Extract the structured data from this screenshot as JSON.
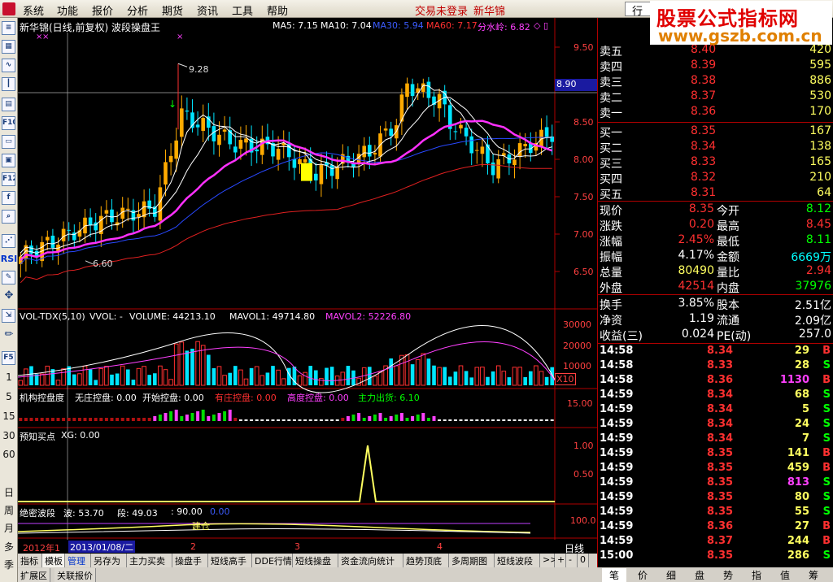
{
  "menu": {
    "items": [
      "系统",
      "功能",
      "报价",
      "分析",
      "期货",
      "资讯",
      "工具",
      "帮助"
    ],
    "status_login": "交易未登录",
    "stock_name": "新华锦",
    "hang": "行"
  },
  "watermark": {
    "line1": "股票公式指标网",
    "line2": "www.gszb.com.cn"
  },
  "left_toolbar": {
    "rsi": "RSI",
    "f5": "F5",
    "periods": [
      "1",
      "5",
      "15",
      "30",
      "60",
      "日",
      "周",
      "月",
      "多",
      "季"
    ]
  },
  "chart": {
    "main_title": "新华锦(日线,前复权) 波段操盘王",
    "ma_labels": [
      {
        "text": "MA5: 7.15",
        "color": "#ffffff"
      },
      {
        "text": "MA10: 7.04",
        "color": "#ffffff"
      },
      {
        "text": "MA30: 5.94",
        "color": "#3c5cff"
      },
      {
        "text": "MA60: 7.17",
        "color": "#ff3030"
      },
      {
        "text": "分水岭: 6.82",
        "color": "#ff40ff"
      }
    ],
    "price_axis": [
      "9.50",
      "9.00",
      "8.50",
      "8.00",
      "7.50",
      "7.00",
      "6.50"
    ],
    "current_price_tag": "8.90",
    "high_label": "9.28",
    "low_label": "6.60",
    "vol_title": {
      "name": "VOL-TDX(5,10)",
      "vvol": "VVOL: -",
      "volume": "VOLUME: 44213.10",
      "mavol1": "MAVOL1: 49714.80",
      "mavol2": "MAVOL2: 52226.80"
    },
    "vol_axis": [
      "30000",
      "20000",
      "10000"
    ],
    "vol_unit": "X10",
    "inst_title": {
      "name": "机构控盘度",
      "a": "无庄控盘: 0.00",
      "b": "开始控盘: 0.00",
      "c": "有庄控盘: 0.00",
      "d": "高度控盘: 0.00",
      "e": "主力出货: 6.10"
    },
    "inst_axis": "15.00",
    "pre_title": {
      "name": "预知买点",
      "xg": "XG: 0.00"
    },
    "pre_axis": [
      "1.00",
      "0.50"
    ],
    "wave_title": {
      "name": "绝密波段",
      "bo": "波: 53.70",
      "duan": "段: 49.03",
      "v": ": 90.00",
      "v2": "0.00"
    },
    "wave_axis": "100.0",
    "wave_label": "建仓",
    "x_axis": {
      "year": "2012年1",
      "date": "2013/01/08/二",
      "m2": "2",
      "m3": "3",
      "m4": "4",
      "period": "日线"
    }
  },
  "chart_data": {
    "type": "candlestick",
    "title": "新华锦(日线,前复权) 波段操盘王",
    "ylim": [
      6.2,
      9.7
    ],
    "series": [
      {
        "name": "MA5",
        "last": 7.15
      },
      {
        "name": "MA10",
        "last": 7.04
      },
      {
        "name": "MA30",
        "last": 5.94
      },
      {
        "name": "MA60",
        "last": 7.17
      },
      {
        "name": "分水岭",
        "last": 6.82
      }
    ],
    "annotations": {
      "high": 9.28,
      "low": 6.6,
      "crosshair": 8.9
    }
  },
  "quote": {
    "sell": [
      {
        "label": "卖五",
        "price": "8.40",
        "vol": "420"
      },
      {
        "label": "卖四",
        "price": "8.39",
        "vol": "595"
      },
      {
        "label": "卖三",
        "price": "8.38",
        "vol": "886"
      },
      {
        "label": "卖二",
        "price": "8.37",
        "vol": "530"
      },
      {
        "label": "卖一",
        "price": "8.36",
        "vol": "170"
      }
    ],
    "buy": [
      {
        "label": "买一",
        "price": "8.35",
        "vol": "167"
      },
      {
        "label": "买二",
        "price": "8.34",
        "vol": "138"
      },
      {
        "label": "买三",
        "price": "8.33",
        "vol": "165"
      },
      {
        "label": "买四",
        "price": "8.32",
        "vol": "210"
      },
      {
        "label": "买五",
        "price": "8.31",
        "vol": "64"
      }
    ],
    "stats": [
      {
        "l1": "现价",
        "v1": "8.35",
        "c1": "#ff3030",
        "l2": "今开",
        "v2": "8.12",
        "c2": "#00ff00"
      },
      {
        "l1": "涨跌",
        "v1": "0.20",
        "c1": "#ff3030",
        "l2": "最高",
        "v2": "8.45",
        "c2": "#ff3030"
      },
      {
        "l1": "涨幅",
        "v1": "2.45%",
        "c1": "#ff3030",
        "l2": "最低",
        "v2": "8.11",
        "c2": "#00ff00"
      },
      {
        "l1": "振幅",
        "v1": "4.17%",
        "c1": "#ffffff",
        "l2": "金额",
        "v2": "6669万",
        "c2": "#00ffff"
      },
      {
        "l1": "总量",
        "v1": "80490",
        "c1": "#ffff60",
        "l2": "量比",
        "v2": "2.94",
        "c2": "#ff3030"
      },
      {
        "l1": "外盘",
        "v1": "42514",
        "c1": "#ff3030",
        "l2": "内盘",
        "v2": "37976",
        "c2": "#00ff00"
      }
    ],
    "finance": [
      {
        "l1": "换手",
        "v1": "3.85%",
        "l2": "股本",
        "v2": "2.51亿"
      },
      {
        "l1": "净资",
        "v1": "1.19",
        "l2": "流通",
        "v2": "2.09亿"
      },
      {
        "l1": "收益(三)",
        "v1": "0.024",
        "l2": "PE(动)",
        "v2": "257.0"
      }
    ],
    "ticks": [
      {
        "time": "14:58",
        "price": "8.34",
        "vol": "29",
        "vc": "#ffff60",
        "bs": "B"
      },
      {
        "time": "14:58",
        "price": "8.33",
        "vol": "28",
        "vc": "#ffff60",
        "bs": "S"
      },
      {
        "time": "14:58",
        "price": "8.36",
        "vol": "1130",
        "vc": "#ff40ff",
        "bs": "B"
      },
      {
        "time": "14:59",
        "price": "8.34",
        "vol": "68",
        "vc": "#ffff60",
        "bs": "S"
      },
      {
        "time": "14:59",
        "price": "8.34",
        "vol": "5",
        "vc": "#ffff60",
        "bs": "S"
      },
      {
        "time": "14:59",
        "price": "8.34",
        "vol": "24",
        "vc": "#ffff60",
        "bs": "S"
      },
      {
        "time": "14:59",
        "price": "8.34",
        "vol": "7",
        "vc": "#ffff60",
        "bs": "S"
      },
      {
        "time": "14:59",
        "price": "8.35",
        "vol": "141",
        "vc": "#ffff60",
        "bs": "B"
      },
      {
        "time": "14:59",
        "price": "8.35",
        "vol": "459",
        "vc": "#ffff60",
        "bs": "B"
      },
      {
        "time": "14:59",
        "price": "8.35",
        "vol": "813",
        "vc": "#ff40ff",
        "bs": "S"
      },
      {
        "time": "14:59",
        "price": "8.35",
        "vol": "80",
        "vc": "#ffff60",
        "bs": "S"
      },
      {
        "time": "14:59",
        "price": "8.35",
        "vol": "55",
        "vc": "#ffff60",
        "bs": "S"
      },
      {
        "time": "14:59",
        "price": "8.36",
        "vol": "27",
        "vc": "#ffff60",
        "bs": "B"
      },
      {
        "time": "14:59",
        "price": "8.37",
        "vol": "244",
        "vc": "#ffff60",
        "bs": "B"
      },
      {
        "time": "15:00",
        "price": "8.35",
        "vol": "286",
        "vc": "#ffff60",
        "bs": "S"
      }
    ]
  },
  "bottom_tabs": [
    "指标",
    "模板",
    "管理",
    "另存为",
    "主力买卖",
    "操盘手",
    "短线高手",
    "DDE行情",
    "短线操盘",
    "资金流向统计",
    "趋势顶底",
    "多周期图",
    "短线波段",
    ">>",
    "+",
    "-",
    "0"
  ],
  "bottom_tabs2": [
    "扩展区",
    "关联报价"
  ],
  "right_tabs": [
    "笔",
    "价",
    "细",
    "盘",
    "势",
    "指",
    "值",
    "筹"
  ]
}
